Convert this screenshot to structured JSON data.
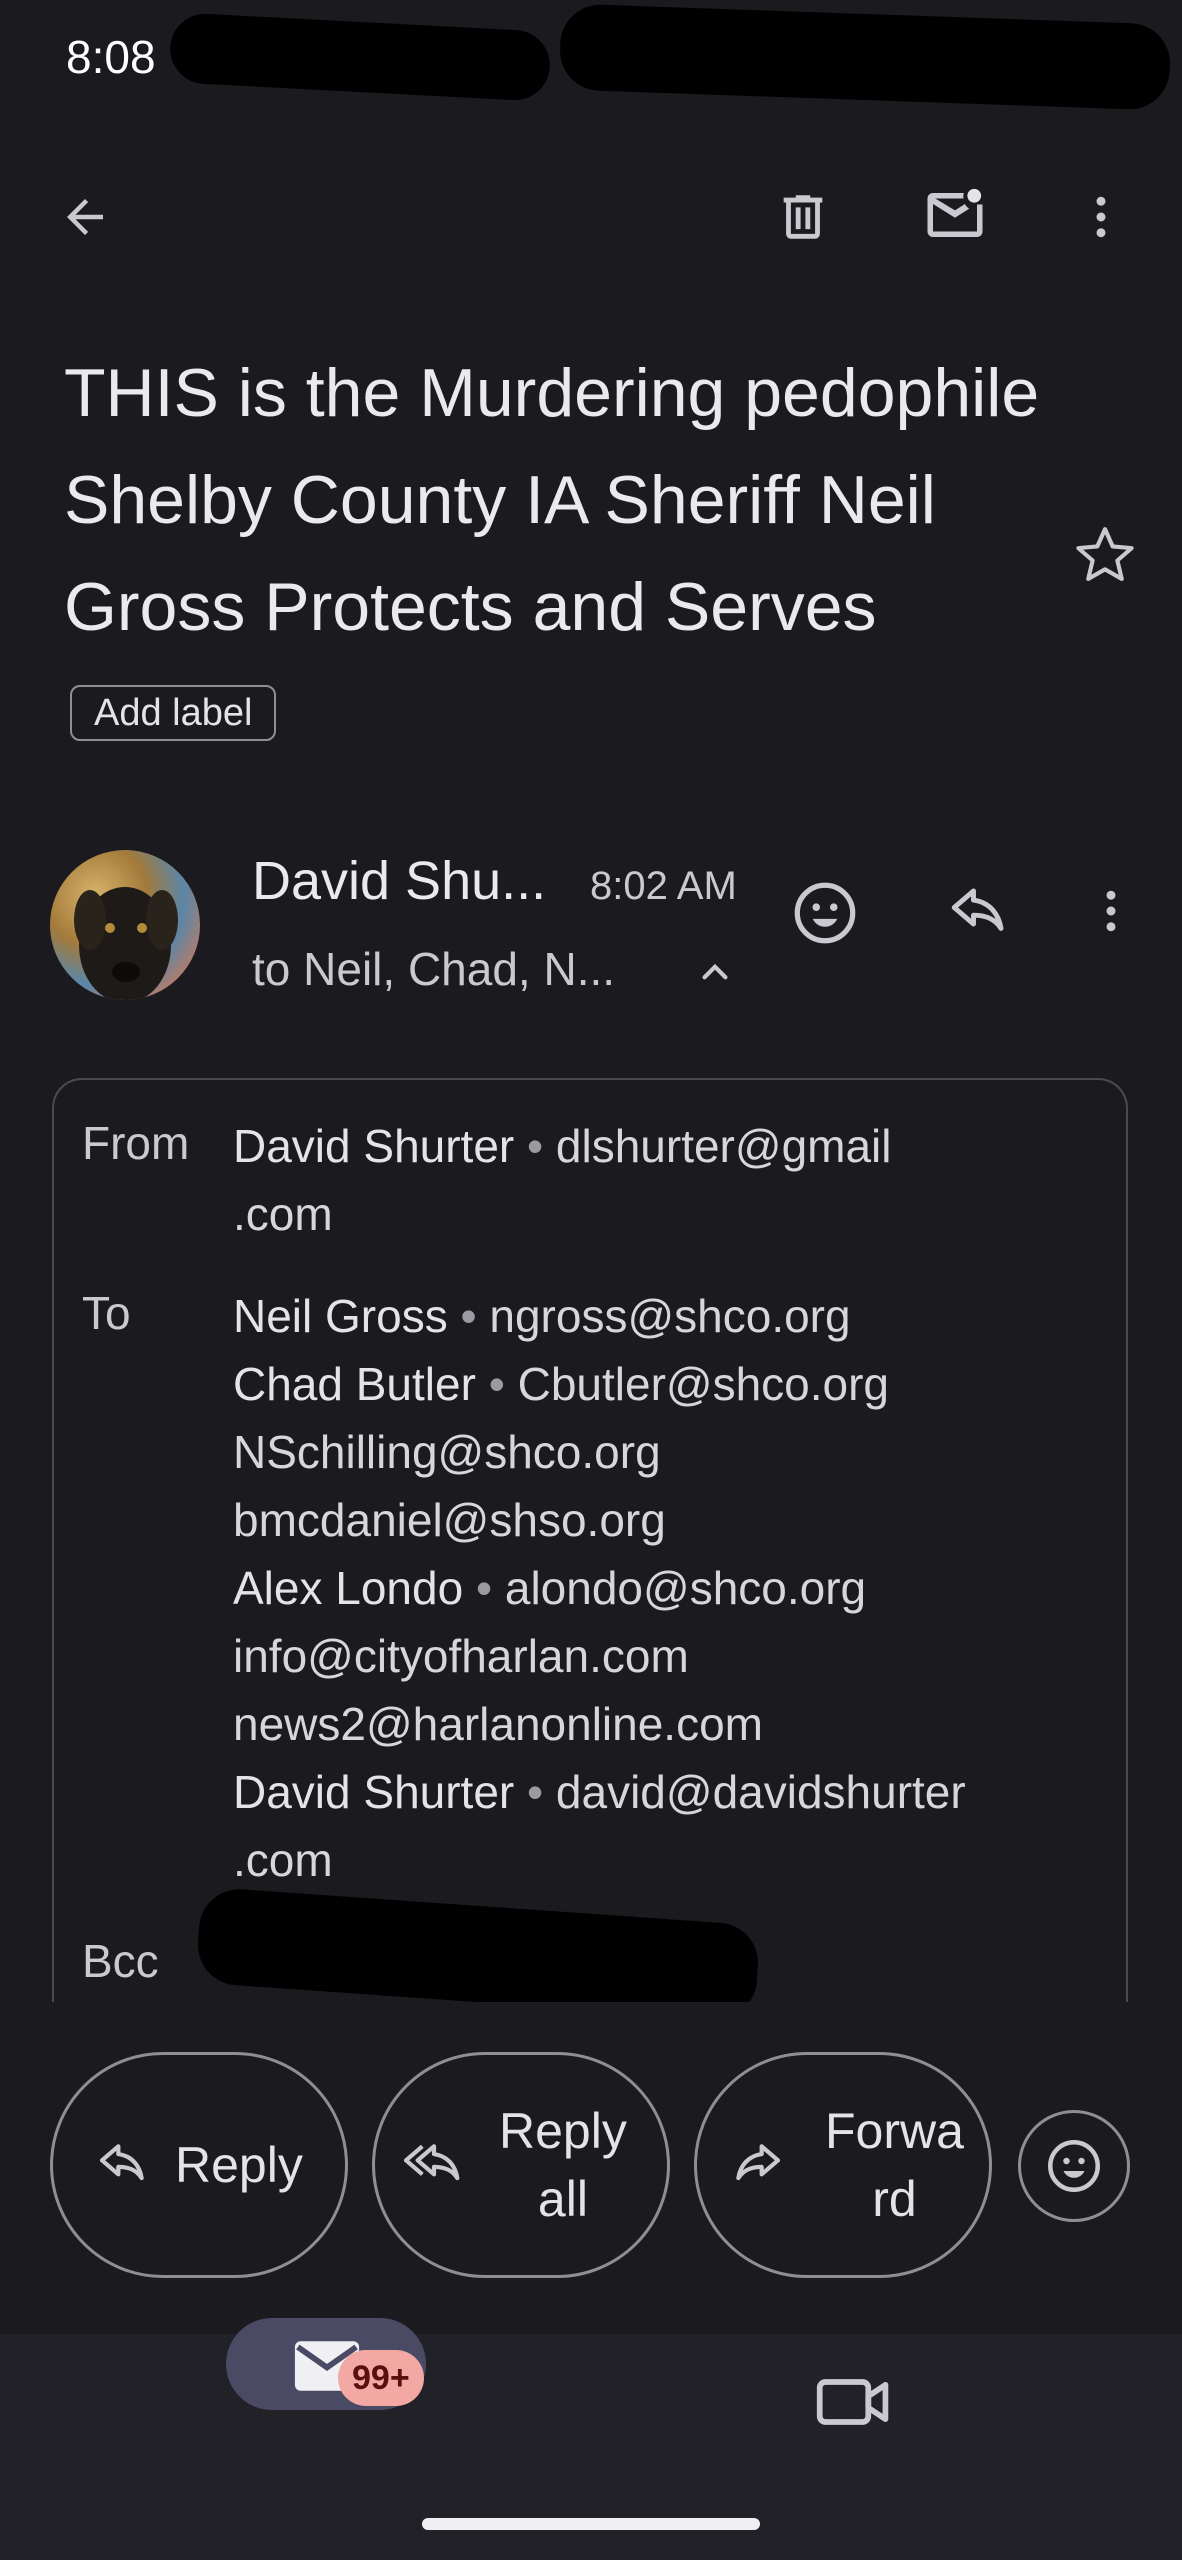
{
  "status_bar": {
    "time": "8:08"
  },
  "email": {
    "subject": "THIS is the Murdering pedophile Shelby County IA Sheriff Neil Gross Protects and Serves",
    "add_label": "Add label",
    "sender_short": "David Shu...",
    "time": "8:02 AM",
    "recipients_summary": "to Neil, Chad, N...",
    "details": {
      "from_label": "From",
      "from_name": "David Shurter",
      "from_email_line1": "dlshurter@gmail",
      "from_email_line2": ".com",
      "to_label": "To",
      "to": [
        {
          "name": "Neil Gross",
          "email": "ngross@shco.org"
        },
        {
          "name": "Chad Butler",
          "email": "Cbutler@shco.org"
        },
        {
          "name": "",
          "email": "NSchilling@shco.org"
        },
        {
          "name": "",
          "email": "bmcdaniel@shso.org"
        },
        {
          "name": "Alex Londo",
          "email": "alondo@shco.org"
        },
        {
          "name": "",
          "email": "info@cityofharlan.com"
        },
        {
          "name": "",
          "email": "news2@harlanonline.com"
        },
        {
          "name": "David Shurter",
          "email": "david@davidshurter"
        }
      ],
      "to_last_line2": ".com",
      "bcc_label": "Bcc"
    }
  },
  "actions": {
    "reply": "Reply",
    "reply_all_line1": "Reply",
    "reply_all_line2": "all",
    "forward_line1": "Forwa",
    "forward_line2": "rd"
  },
  "bottom_nav": {
    "mail_badge": "99+"
  }
}
